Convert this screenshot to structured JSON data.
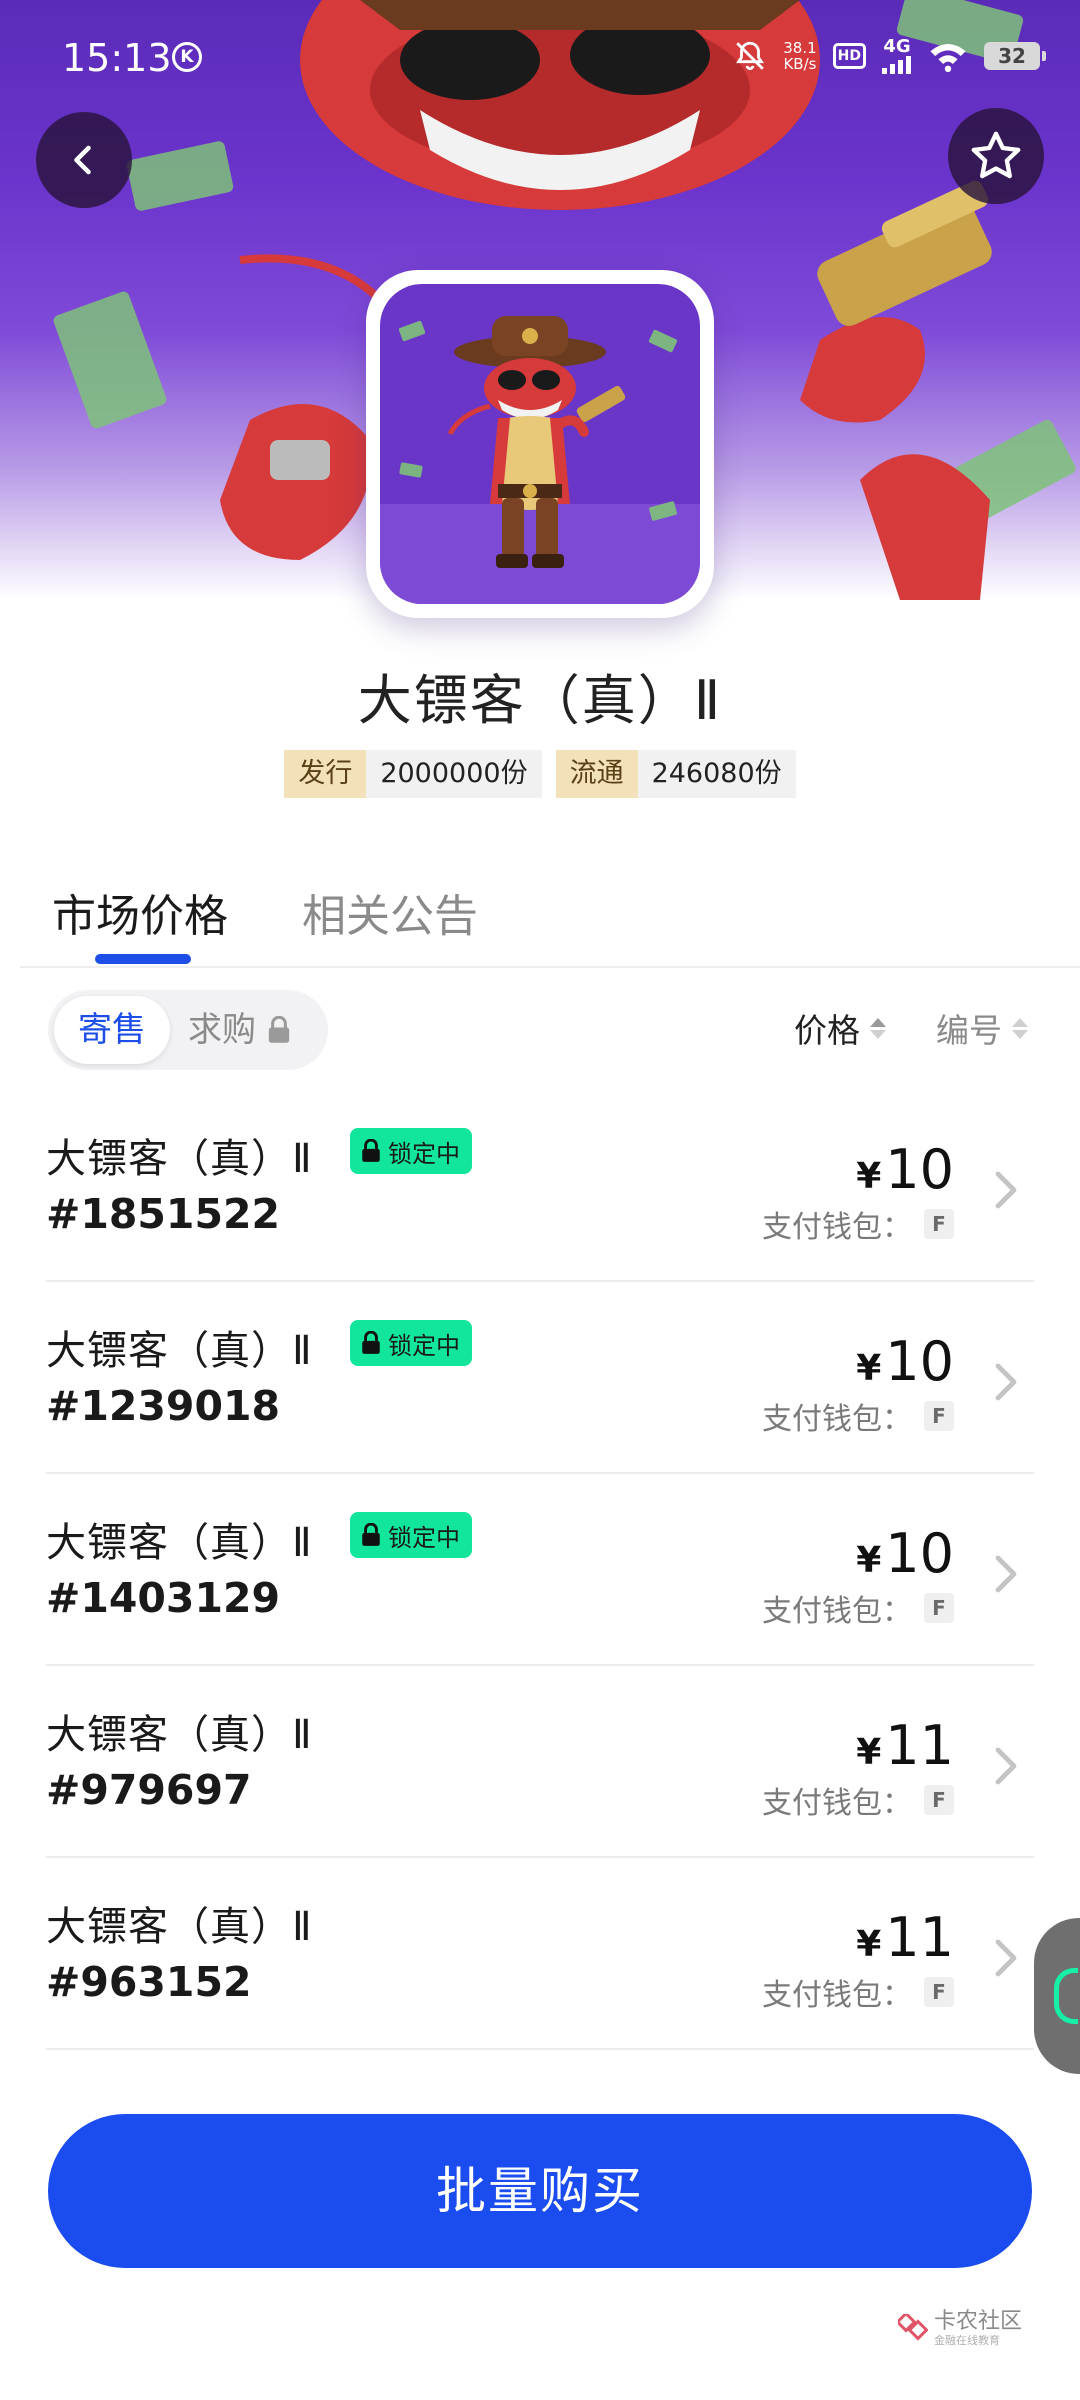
{
  "status_bar": {
    "time": "15:13",
    "k_icon": "K",
    "net_speed_value": "38.1",
    "net_speed_unit": "KB/s",
    "hd": "HD",
    "network": "4G",
    "battery": "32"
  },
  "product": {
    "title": "大镖客（真）Ⅱ",
    "issue_label": "发行",
    "issue_value": "2000000份",
    "circulation_label": "流通",
    "circulation_value": "246080份"
  },
  "tabs": [
    {
      "label": "市场价格",
      "active": true
    },
    {
      "label": "相关公告",
      "active": false
    }
  ],
  "filters": {
    "consign": "寄售",
    "seek": "求购",
    "sort_price": "价格",
    "sort_number": "编号"
  },
  "listings": [
    {
      "name": "大镖客（真）Ⅱ",
      "serial": "#1851522",
      "locked": true,
      "lock_label": "锁定中",
      "currency": "¥",
      "price": "10",
      "pay_label": "支付钱包：",
      "pay_method": "F"
    },
    {
      "name": "大镖客（真）Ⅱ",
      "serial": "#1239018",
      "locked": true,
      "lock_label": "锁定中",
      "currency": "¥",
      "price": "10",
      "pay_label": "支付钱包：",
      "pay_method": "F"
    },
    {
      "name": "大镖客（真）Ⅱ",
      "serial": "#1403129",
      "locked": true,
      "lock_label": "锁定中",
      "currency": "¥",
      "price": "10",
      "pay_label": "支付钱包：",
      "pay_method": "F"
    },
    {
      "name": "大镖客（真）Ⅱ",
      "serial": "#979697",
      "locked": false,
      "lock_label": "",
      "currency": "¥",
      "price": "11",
      "pay_label": "支付钱包：",
      "pay_method": "F"
    },
    {
      "name": "大镖客（真）Ⅱ",
      "serial": "#963152",
      "locked": false,
      "lock_label": "",
      "currency": "¥",
      "price": "11",
      "pay_label": "支付钱包：",
      "pay_method": "F"
    }
  ],
  "cta": {
    "label": "批量购买"
  },
  "watermark": {
    "main": "卡农社区",
    "sub": "金融在线教育"
  },
  "colors": {
    "accent": "#1a4cf0",
    "lock_badge": "#12e69a",
    "chip_key_bg": "#f3e1b9",
    "hero_purple": "#6b34cc"
  },
  "icons": {
    "back": "chevron-left-icon",
    "favorite": "star-outline-icon",
    "lock": "lock-icon",
    "row_arrow": "chevron-right-icon"
  }
}
